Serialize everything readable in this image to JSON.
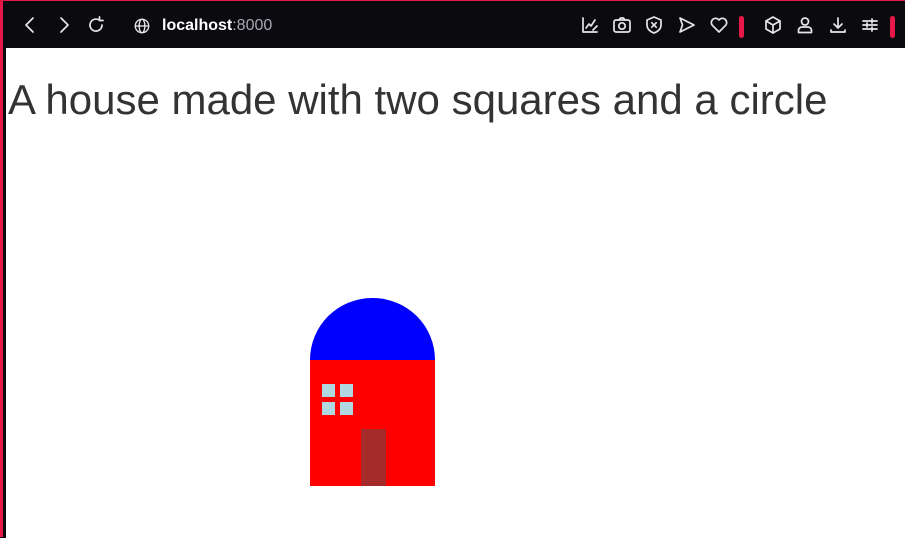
{
  "browser": {
    "url_host": "localhost",
    "url_port": ":8000",
    "accent_color": "#e8174a",
    "toolbar_background": "#0b0b0f",
    "nav_buttons": [
      {
        "name": "back-button",
        "icon": "chevron-left-icon"
      },
      {
        "name": "forward-button",
        "icon": "chevron-right-icon"
      },
      {
        "name": "reload-button",
        "icon": "reload-icon"
      }
    ],
    "toolbar_icons": [
      "edit-chart-icon",
      "camera-icon",
      "shield-x-icon",
      "send-icon",
      "heart-icon",
      "box-icon",
      "user-icon",
      "download-icon",
      "sliders-icon"
    ]
  },
  "page": {
    "title": "A house made with two squares and a circle",
    "background": "#ffffff",
    "title_color": "#333333"
  },
  "house": {
    "roof_color": "#0000ff",
    "wall_color": "#ff0000",
    "window_color": "#b0d8e0",
    "door_color": "#a52a2a"
  }
}
